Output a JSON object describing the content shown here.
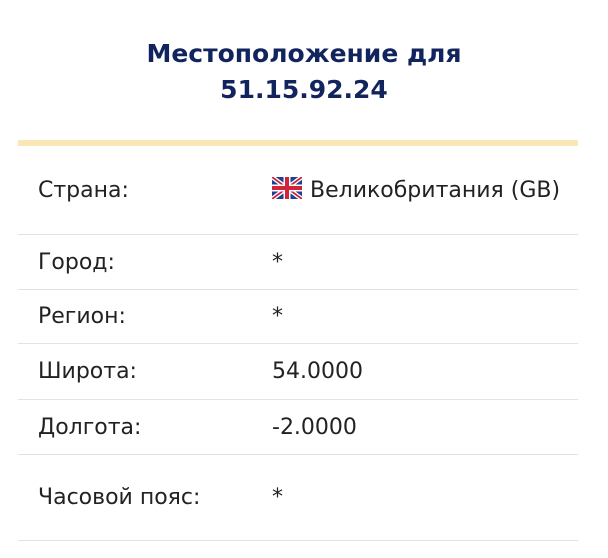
{
  "title": {
    "line1": "Местоположение для",
    "line2": "51.15.92.24"
  },
  "rows": [
    {
      "label": "Страна:",
      "value": "Великобритания (GB)",
      "icon": "uk-flag-icon"
    },
    {
      "label": "Город:",
      "value": "*"
    },
    {
      "label": "Регион:",
      "value": "*"
    },
    {
      "label": "Широта:",
      "value": "54.0000"
    },
    {
      "label": "Долгота:",
      "value": "-2.0000"
    },
    {
      "label": "Часовой пояс:",
      "value": "*"
    }
  ],
  "colors": {
    "title": "#12245e",
    "accent_bar": "#fbe6b5",
    "row_border": "#e3e3e3",
    "text": "#222222"
  }
}
